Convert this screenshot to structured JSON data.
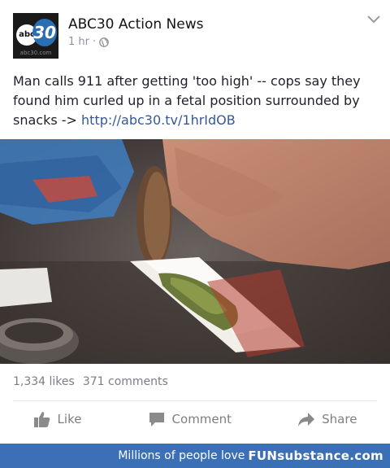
{
  "header": {
    "page_name": "ABC30 Action News",
    "time": "1 hr",
    "separator": "·",
    "avatar": {
      "left": "abc",
      "right": "30",
      "strip": "abc30.com"
    }
  },
  "post": {
    "text": "Man calls 911 after getting 'too high' -- cops say they found him curled up in a fetal position surrounded by snacks -> ",
    "link": "http://abc30.tv/1hrIdOB"
  },
  "stats": {
    "likes": "1,334 likes",
    "comments": "371 comments"
  },
  "actions": {
    "like": "Like",
    "comment": "Comment",
    "share": "Share"
  },
  "banner": {
    "text": "Millions of people love",
    "brand": "FUNsubstance.com"
  },
  "colors": {
    "link": "#365899",
    "banner": "#3b6fb6",
    "muted": "#7f7f7f"
  },
  "icons": [
    "globe-icon",
    "chevron-down-icon",
    "thumbs-up-icon",
    "comment-icon",
    "share-arrow-icon"
  ]
}
